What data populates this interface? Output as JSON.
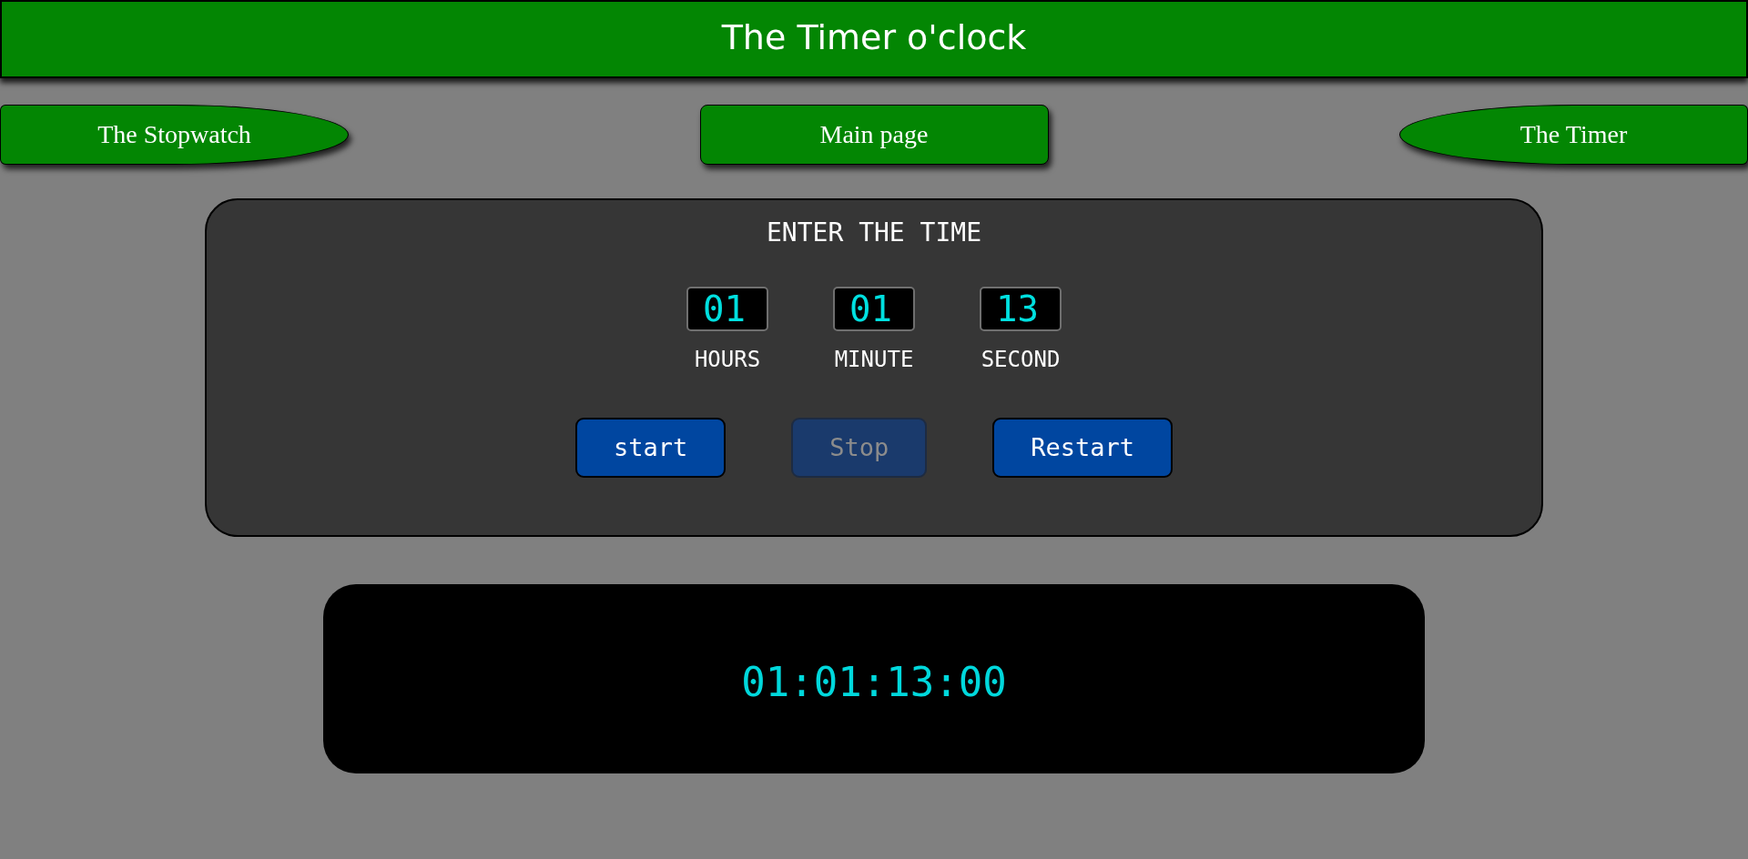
{
  "header": {
    "title": "The Timer o'clock"
  },
  "nav": [
    {
      "label": "The Stopwatch",
      "kind": "left"
    },
    {
      "label": "Main page",
      "kind": "center"
    },
    {
      "label": "The Timer",
      "kind": "right"
    }
  ],
  "timer_form": {
    "title": "ENTER THE TIME",
    "fields": [
      {
        "label": "HOURS",
        "value": "01"
      },
      {
        "label": "MINUTE",
        "value": "01"
      },
      {
        "label": "SECOND",
        "value": "13"
      }
    ],
    "buttons": [
      {
        "label": "start",
        "disabled": false
      },
      {
        "label": "Stop",
        "disabled": true
      },
      {
        "label": "Restart",
        "disabled": false
      }
    ]
  },
  "display": {
    "reading": "01:01:13:00"
  }
}
